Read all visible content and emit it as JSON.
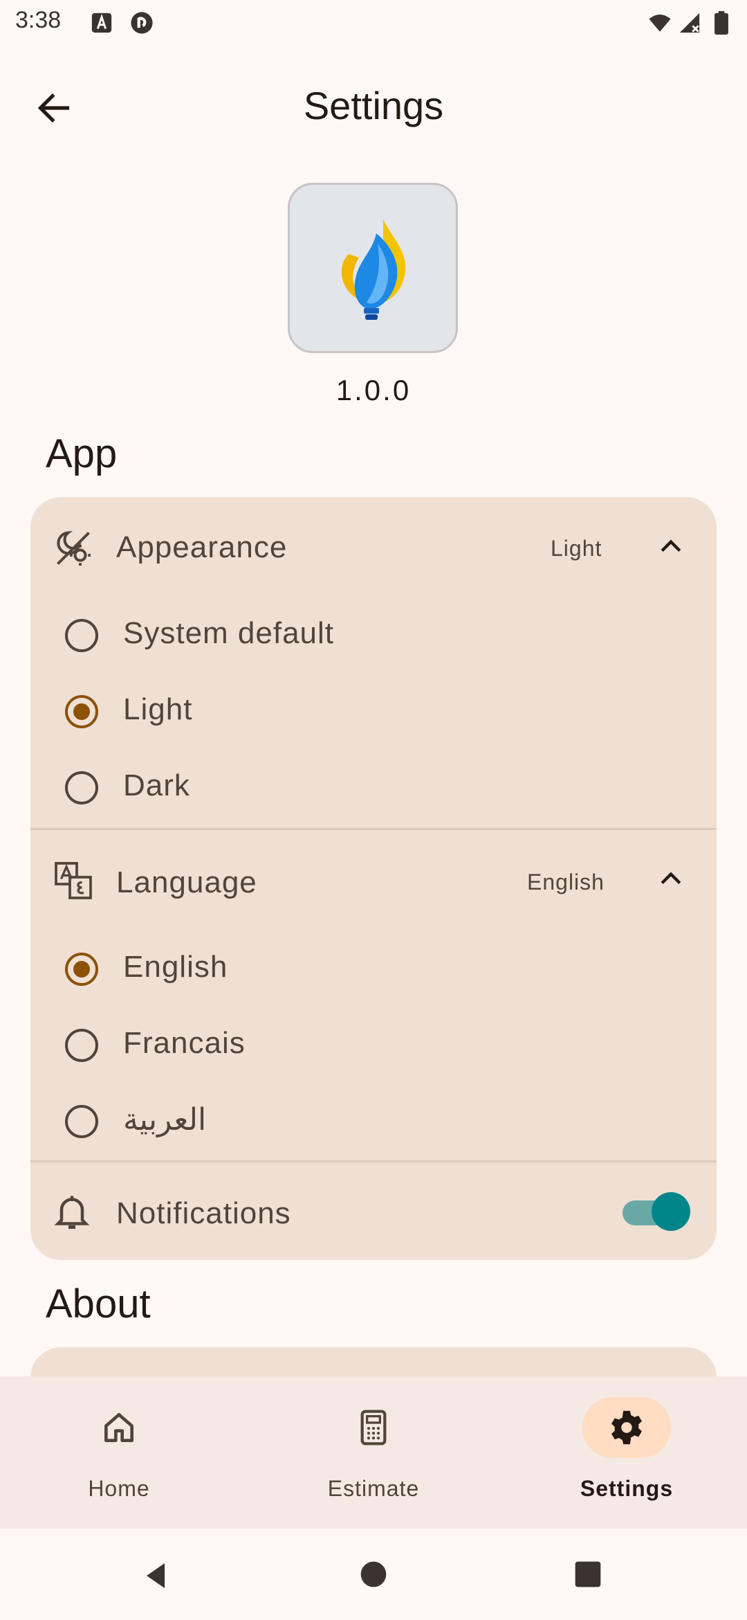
{
  "status_bar": {
    "time": "3:38",
    "left_icons": [
      "font-notification-icon",
      "pocket-casts-icon"
    ],
    "right_icons": [
      "wifi-icon",
      "signal-icon",
      "battery-icon"
    ]
  },
  "header": {
    "title": "Settings",
    "back_icon": "arrow-back-icon"
  },
  "app_info": {
    "logo": "flame-bulb-logo",
    "version": "1.0.0"
  },
  "sections": {
    "app_title": "App",
    "about_title": "About"
  },
  "appearance": {
    "label": "Appearance",
    "value": "Light",
    "options": [
      {
        "label": "System default",
        "selected": false
      },
      {
        "label": "Light",
        "selected": true
      },
      {
        "label": "Dark",
        "selected": false
      }
    ]
  },
  "language": {
    "label": "Language",
    "value": "English",
    "options": [
      {
        "label": "English",
        "selected": true
      },
      {
        "label": "Francais",
        "selected": false
      },
      {
        "label": "العربية",
        "selected": false
      }
    ]
  },
  "notifications": {
    "label": "Notifications",
    "enabled": true
  },
  "bottom_nav": {
    "items": [
      {
        "label": "Home",
        "icon": "home-icon",
        "active": false
      },
      {
        "label": "Estimate",
        "icon": "calculator-icon",
        "active": false
      },
      {
        "label": "Settings",
        "icon": "gear-icon",
        "active": true
      }
    ]
  },
  "colors": {
    "background": "#fff8f5",
    "card": "#f0e0d4",
    "accent": "#8b5208",
    "switch": "#00858a",
    "nav_active_pill": "#ffdcc2"
  }
}
